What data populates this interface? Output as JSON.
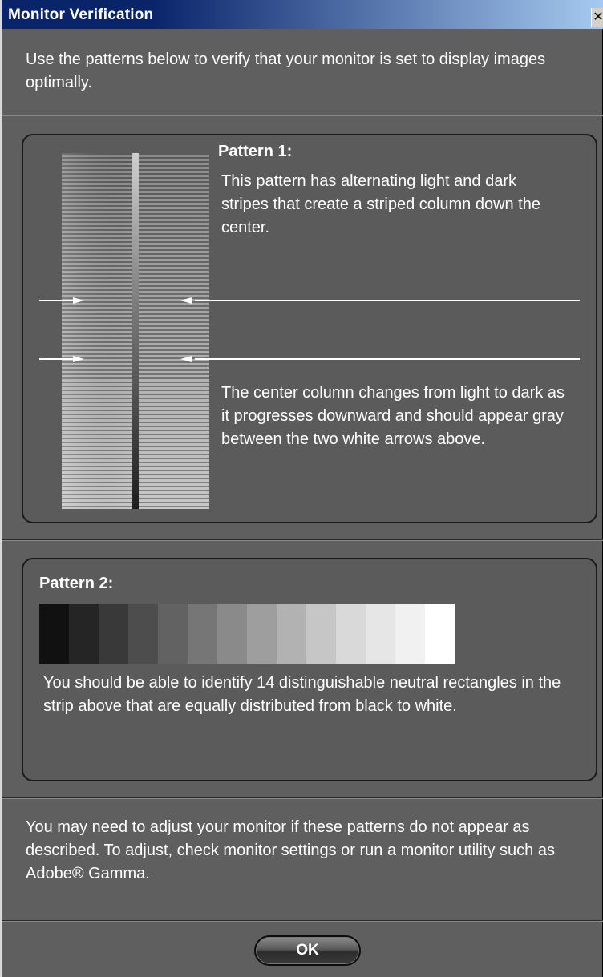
{
  "window": {
    "title": "Monitor Verification",
    "close_glyph": "✕"
  },
  "intro": "Use the patterns below to verify that your monitor is set to display images optimally.",
  "pattern1": {
    "heading": "Pattern 1:",
    "description_top": "This pattern has alternating light and dark stripes that create a striped column down the center.",
    "description_bottom": "The center column changes from light to dark as it progresses downward and should appear gray between the two white arrows above."
  },
  "pattern2": {
    "heading": "Pattern 2:",
    "description": "You should be able to identify 14 distinguishable neutral rectangles in the strip above that are equally distributed from black to white.",
    "swatches": [
      "#111111",
      "#252525",
      "#393939",
      "#4d4d4d",
      "#626262",
      "#767676",
      "#8a8a8a",
      "#9e9e9e",
      "#b2b2b2",
      "#c6c6c6",
      "#d9d9d9",
      "#e6e6e6",
      "#f1f1f1",
      "#ffffff"
    ]
  },
  "outro": "You may need to adjust your monitor if these patterns do not appear as described. To adjust, check monitor settings or run a monitor utility such as Adobe® Gamma.",
  "ok_button": "OK",
  "colors": {
    "dialog_bg": "#5f5f5f",
    "titlebar": "#0a246a",
    "text": "#ffffff"
  }
}
